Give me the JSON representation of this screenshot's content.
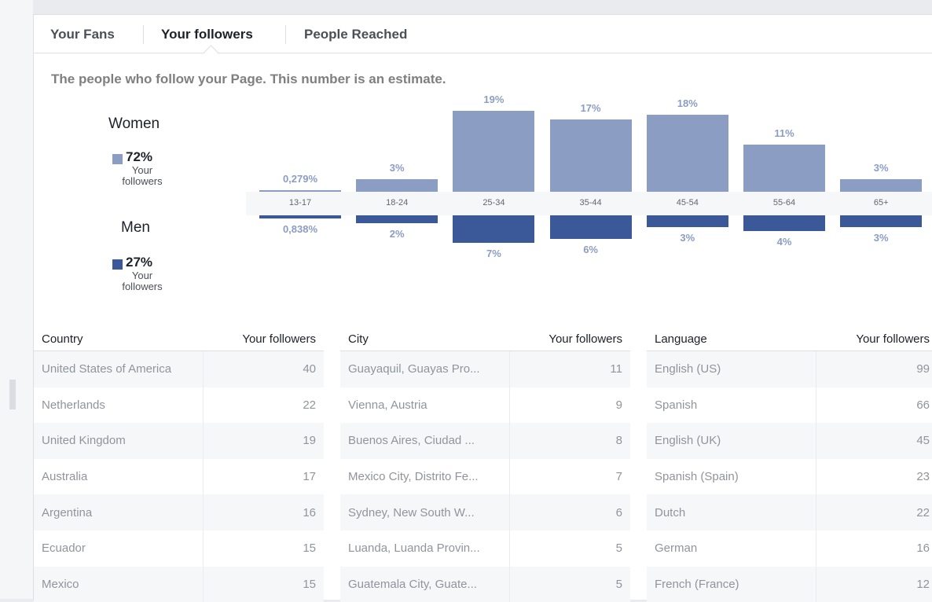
{
  "tabs": [
    {
      "label": "Your Fans"
    },
    {
      "label": "Your followers"
    },
    {
      "label": "People Reached"
    }
  ],
  "description": "The people who follow your Page. This number is an estimate.",
  "legend": {
    "women": {
      "title": "Women",
      "pct": "72%",
      "sub": "Your followers",
      "color": "#8b9dc3"
    },
    "men": {
      "title": "Men",
      "pct": "27%",
      "sub": "Your followers",
      "color": "#3b5998"
    }
  },
  "chart_data": {
    "type": "bar",
    "categories": [
      "13-17",
      "18-24",
      "25-34",
      "35-44",
      "45-54",
      "55-64",
      "65+"
    ],
    "series": [
      {
        "name": "Women",
        "values": [
          0.279,
          3,
          19,
          17,
          18,
          11,
          3
        ],
        "labels": [
          "0,279%",
          "3%",
          "19%",
          "17%",
          "18%",
          "11%",
          "3%"
        ]
      },
      {
        "name": "Men",
        "values": [
          0.838,
          2,
          7,
          6,
          3,
          4,
          3
        ],
        "labels": [
          "0,838%",
          "2%",
          "7%",
          "6%",
          "3%",
          "4%",
          "3%"
        ]
      }
    ]
  },
  "tables": [
    {
      "header": "Country",
      "value_header": "Your followers",
      "rows": [
        {
          "name": "United States of America",
          "value": "40"
        },
        {
          "name": "Netherlands",
          "value": "22"
        },
        {
          "name": "United Kingdom",
          "value": "19"
        },
        {
          "name": "Australia",
          "value": "17"
        },
        {
          "name": "Argentina",
          "value": "16"
        },
        {
          "name": "Ecuador",
          "value": "15"
        },
        {
          "name": "Mexico",
          "value": "15"
        }
      ]
    },
    {
      "header": "City",
      "value_header": "Your followers",
      "rows": [
        {
          "name": "Guayaquil, Guayas Pro...",
          "value": "11"
        },
        {
          "name": "Vienna, Austria",
          "value": "9"
        },
        {
          "name": "Buenos Aires, Ciudad ...",
          "value": "8"
        },
        {
          "name": "Mexico City, Distrito Fe...",
          "value": "7"
        },
        {
          "name": "Sydney, New South W...",
          "value": "6"
        },
        {
          "name": "Luanda, Luanda Provin...",
          "value": "5"
        },
        {
          "name": "Guatemala City, Guate...",
          "value": "5"
        }
      ]
    },
    {
      "header": "Language",
      "value_header": "Your followers",
      "rows": [
        {
          "name": "English (US)",
          "value": "99"
        },
        {
          "name": "Spanish",
          "value": "66"
        },
        {
          "name": "English (UK)",
          "value": "45"
        },
        {
          "name": "Spanish (Spain)",
          "value": "23"
        },
        {
          "name": "Dutch",
          "value": "22"
        },
        {
          "name": "German",
          "value": "16"
        },
        {
          "name": "French (France)",
          "value": "12"
        }
      ]
    }
  ]
}
